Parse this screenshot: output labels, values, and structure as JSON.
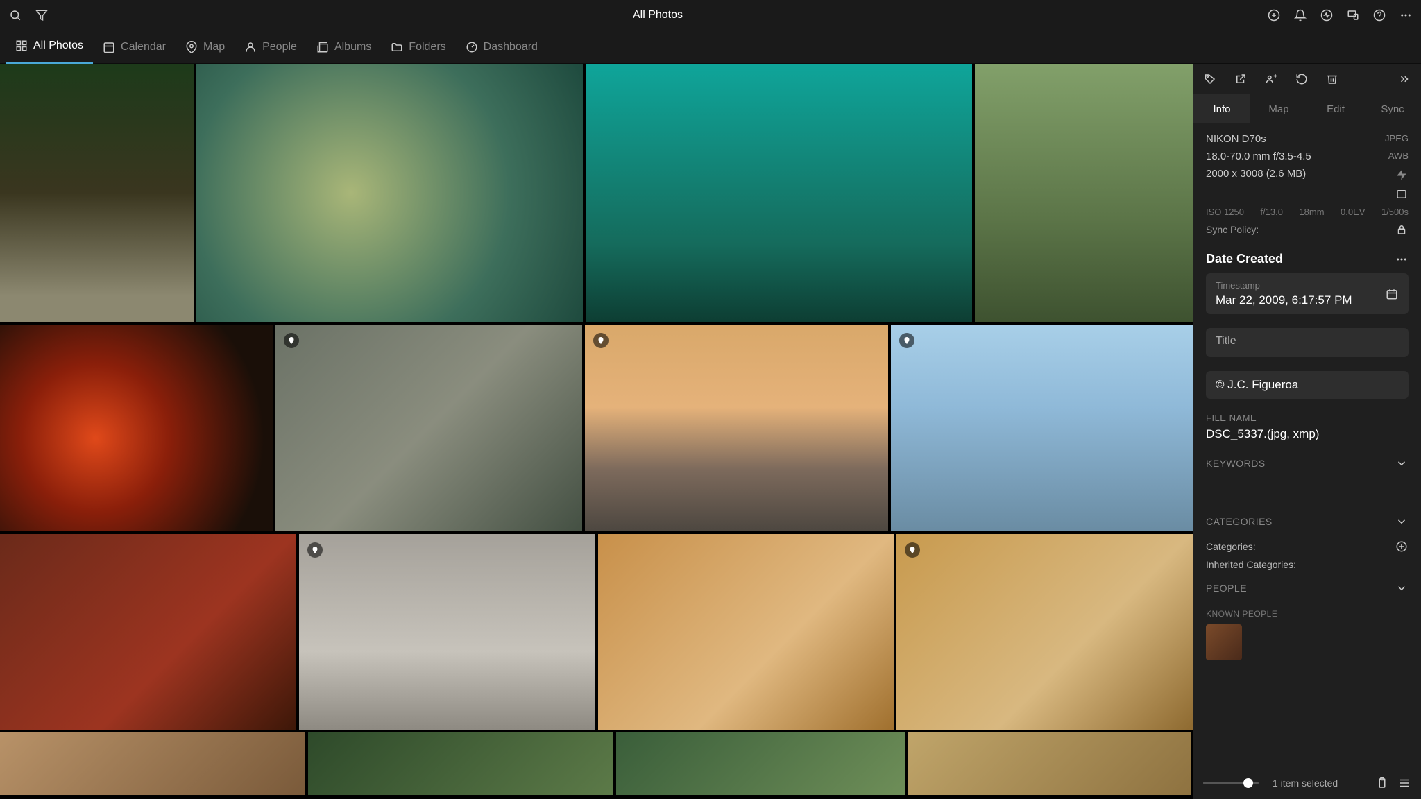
{
  "title": "All Photos",
  "nav": {
    "allPhotos": "All Photos",
    "calendar": "Calendar",
    "map": "Map",
    "people": "People",
    "albums": "Albums",
    "folders": "Folders",
    "dashboard": "Dashboard"
  },
  "panel": {
    "tabs": {
      "info": "Info",
      "map": "Map",
      "edit": "Edit",
      "sync": "Sync"
    },
    "camera": "NIKON D70s",
    "format": "JPEG",
    "lens": "18.0-70.0 mm f/3.5-4.5",
    "wb": "AWB",
    "dims": "2000 x 3008 (2.6 MB)",
    "iso": "ISO 1250",
    "aperture": "f/13.0",
    "focal": "18mm",
    "ev": "0.0EV",
    "shutter": "1/500s",
    "syncPolicy": "Sync Policy:",
    "dateCreated": "Date Created",
    "timestampLabel": "Timestamp",
    "timestamp": "Mar 22, 2009, 6:17:57 PM",
    "titleLabel": "Title",
    "copyright": "© J.C. Figueroa",
    "fileNameLabel": "FILE NAME",
    "fileName": "DSC_5337.(jpg, xmp)",
    "keywords": "KEYWORDS",
    "categories": "CATEGORIES",
    "categoriesLabel": "Categories:",
    "inheritedCategories": "Inherited Categories:",
    "people": "PEOPLE",
    "knownPeople": "KNOWN PEOPLE",
    "selected": "1 item selected"
  }
}
